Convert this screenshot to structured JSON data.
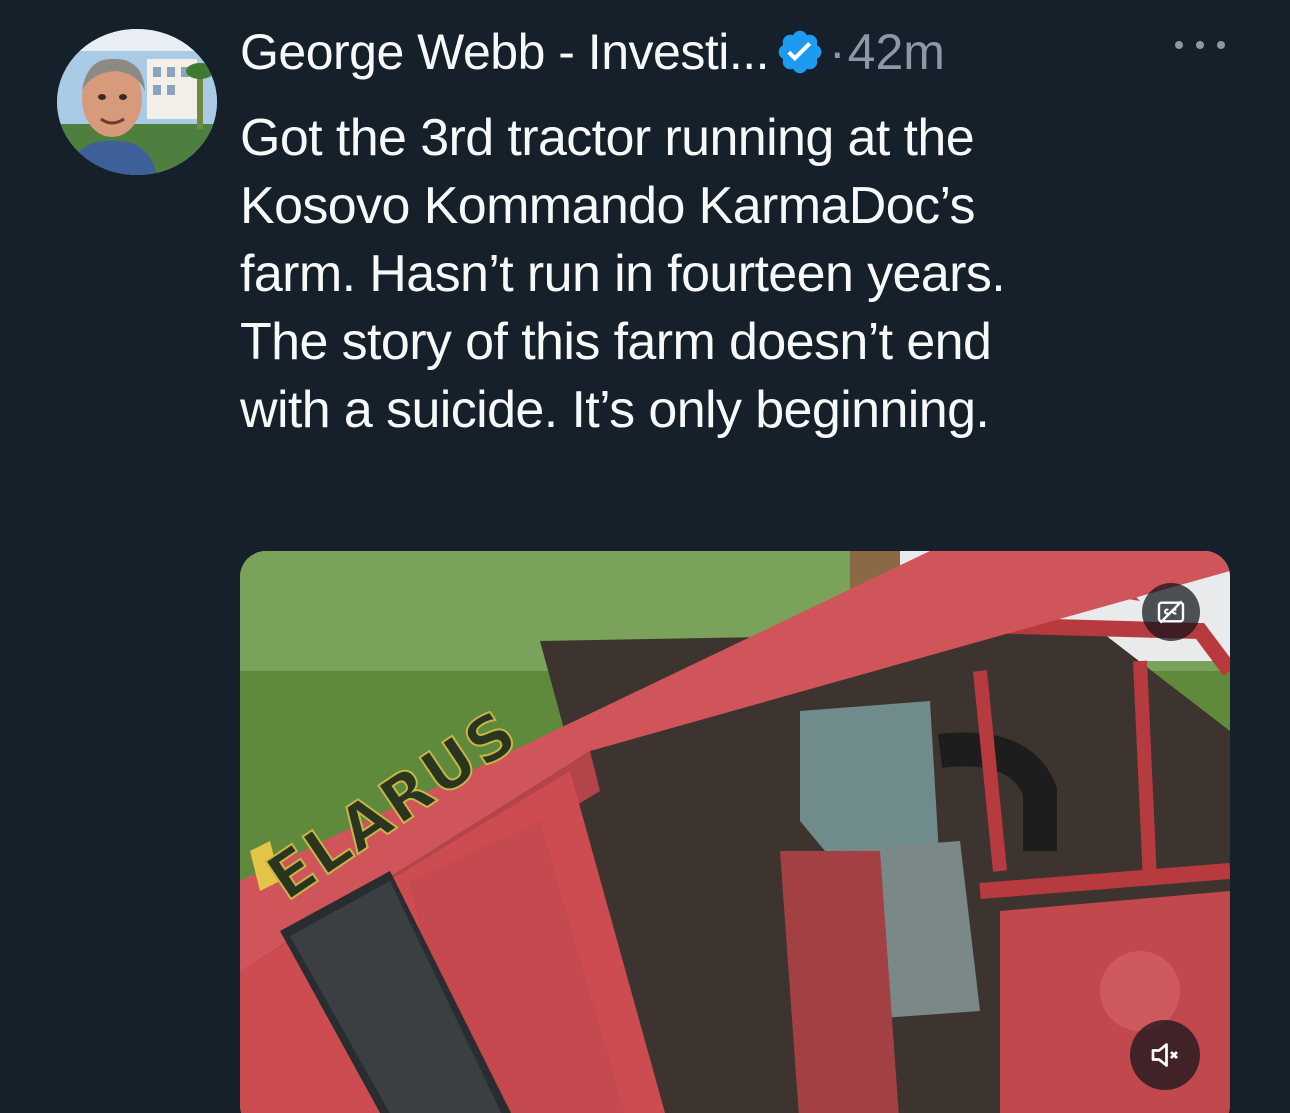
{
  "tweet": {
    "author": {
      "display_name": "George Webb - Investi...",
      "verified": true,
      "avatar_icon": "profile-photo"
    },
    "separator": "·",
    "timestamp": "42m",
    "more_icon": "ellipsis-icon",
    "text_lines": [
      "Got the 3rd tractor running at the",
      "Kosovo Kommando KarmaDoc’s",
      "farm. Hasn’t run in fourteen years.",
      "The story of this farm doesn’t end",
      "with a suicide. It’s only beginning."
    ],
    "media": {
      "type": "video",
      "brand_text": "ELARUS",
      "captions_icon": "closed-captions-off-icon",
      "mute_icon": "speaker-muted-icon"
    }
  },
  "colors": {
    "background": "#15202b",
    "text_primary": "#f7f9f9",
    "text_secondary": "#8b98a5",
    "verified_blue": "#1d9bf0",
    "tractor_red": "#c9454a"
  }
}
